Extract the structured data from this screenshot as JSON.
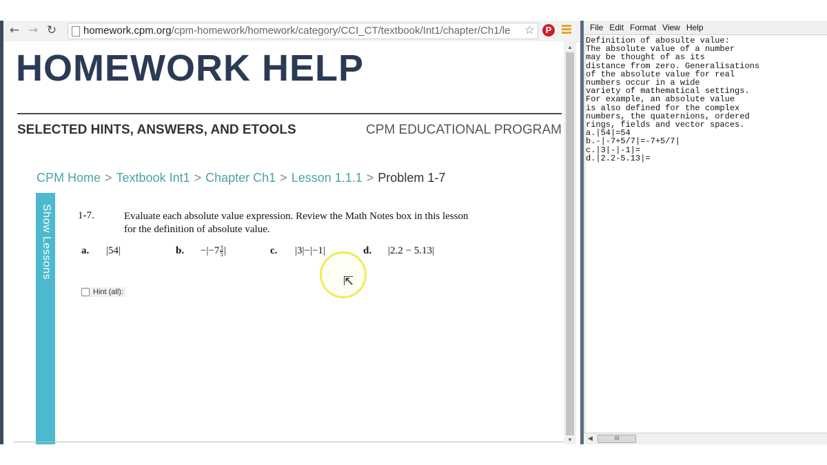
{
  "browser": {
    "url_host": "homework.cpm.org",
    "url_path": "/cpm-homework/homework/category/CCI_CT/textbook/Int1/chapter/Ch1/le",
    "icons": [
      "back-icon",
      "forward-icon",
      "reload-icon",
      "page-icon",
      "bookmark-star-icon",
      "pinterest-icon",
      "menu-icon"
    ],
    "pinterest_glyph": "P"
  },
  "page": {
    "title": "HOMEWORK HELP",
    "subtitle": "SELECTED HINTS, ANSWERS, AND ETOOLS",
    "org": "CPM EDUCATIONAL PROGRAM",
    "breadcrumb": {
      "home": "CPM Home",
      "textbook": "Textbook Int1",
      "chapter": "Chapter Ch1",
      "lesson": "Lesson 1.1.1",
      "current": "Problem 1-7",
      "separator": ">"
    },
    "show_lessons": "Show Lessons",
    "problem": {
      "number": "1-7.",
      "text": "Evaluate each absolute value expression.  Review the Math Notes box in this lesson for the definition of absolute value.",
      "parts": [
        {
          "letter": "a.",
          "expr": "|54|"
        },
        {
          "letter": "b.",
          "expr_pre": "−|−7",
          "frac_num": "3",
          "frac_den": "5",
          "expr_post": "|"
        },
        {
          "letter": "c.",
          "expr": "|3|−|−1|"
        },
        {
          "letter": "d.",
          "expr": "|2.2 − 5.13|"
        }
      ]
    },
    "hint_label": "Hint (all):"
  },
  "notepad": {
    "menu": [
      "File",
      "Edit",
      "Format",
      "View",
      "Help"
    ],
    "content": "Definition of abosulte value:\nThe absolute value of a number\nmay be thought of as its\ndistance from zero. Generalisations\nof the absolute value for real\nnumbers occur in a wide\nvariety of mathematical settings.\nFor example, an absolute value\nis also defined for the complex\nnumbers, the quaternions, ordered\nrings, fields and vector spaces.\na.|54|=54\nb.-|-7+5/7|=-7+5/7|\nc.|3|-|-1|=\nd.|2.2-5.13|=",
    "hscroll_grip": "III"
  },
  "colors": {
    "title": "#2b3a55",
    "breadcrumb_link": "#4aa3a8",
    "show_lessons_bg": "#4cb9cf",
    "cursor_ring": "#f1eb55"
  }
}
